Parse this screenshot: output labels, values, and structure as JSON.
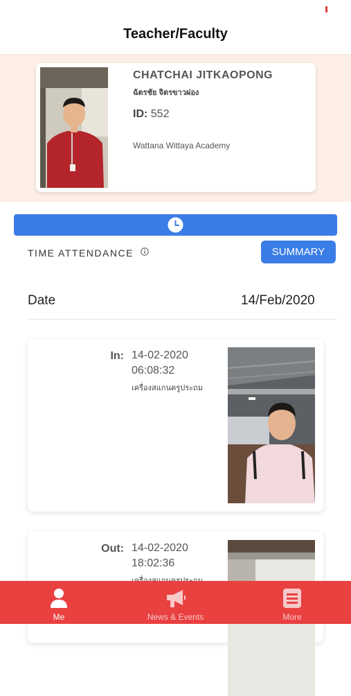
{
  "nav": {
    "title": "Teacher/Faculty"
  },
  "profile": {
    "name": "CHATCHAI JITKAOPONG",
    "name_thai": "ฉัตรชัย จิตรขาวผ่อง",
    "id_label": "ID:",
    "id_value": "552",
    "school": "Wattana Wittaya Academy"
  },
  "attendance": {
    "section_title": "TIME ATTENDANCE",
    "summary_label": "SUMMARY",
    "date_label": "Date",
    "date_value": "14/Feb/2020",
    "entries": [
      {
        "type": "In:",
        "date": "14-02-2020",
        "time": "06:08:32",
        "device": "เครื่องสแกนครูประถม"
      },
      {
        "type": "Out:",
        "date": "14-02-2020",
        "time": "18:02:36",
        "device": "เครื่องสแกนครูประถม"
      }
    ]
  },
  "tabbar": {
    "items": [
      {
        "label": "Me",
        "icon": "person-icon",
        "active": true
      },
      {
        "label": "News & Events",
        "icon": "megaphone-icon",
        "active": false
      },
      {
        "label": "More",
        "icon": "list-icon",
        "active": false
      }
    ]
  },
  "colors": {
    "accent": "#3b7de6",
    "tabbar": "#e94040",
    "profile_bg": "#fdefe6"
  }
}
